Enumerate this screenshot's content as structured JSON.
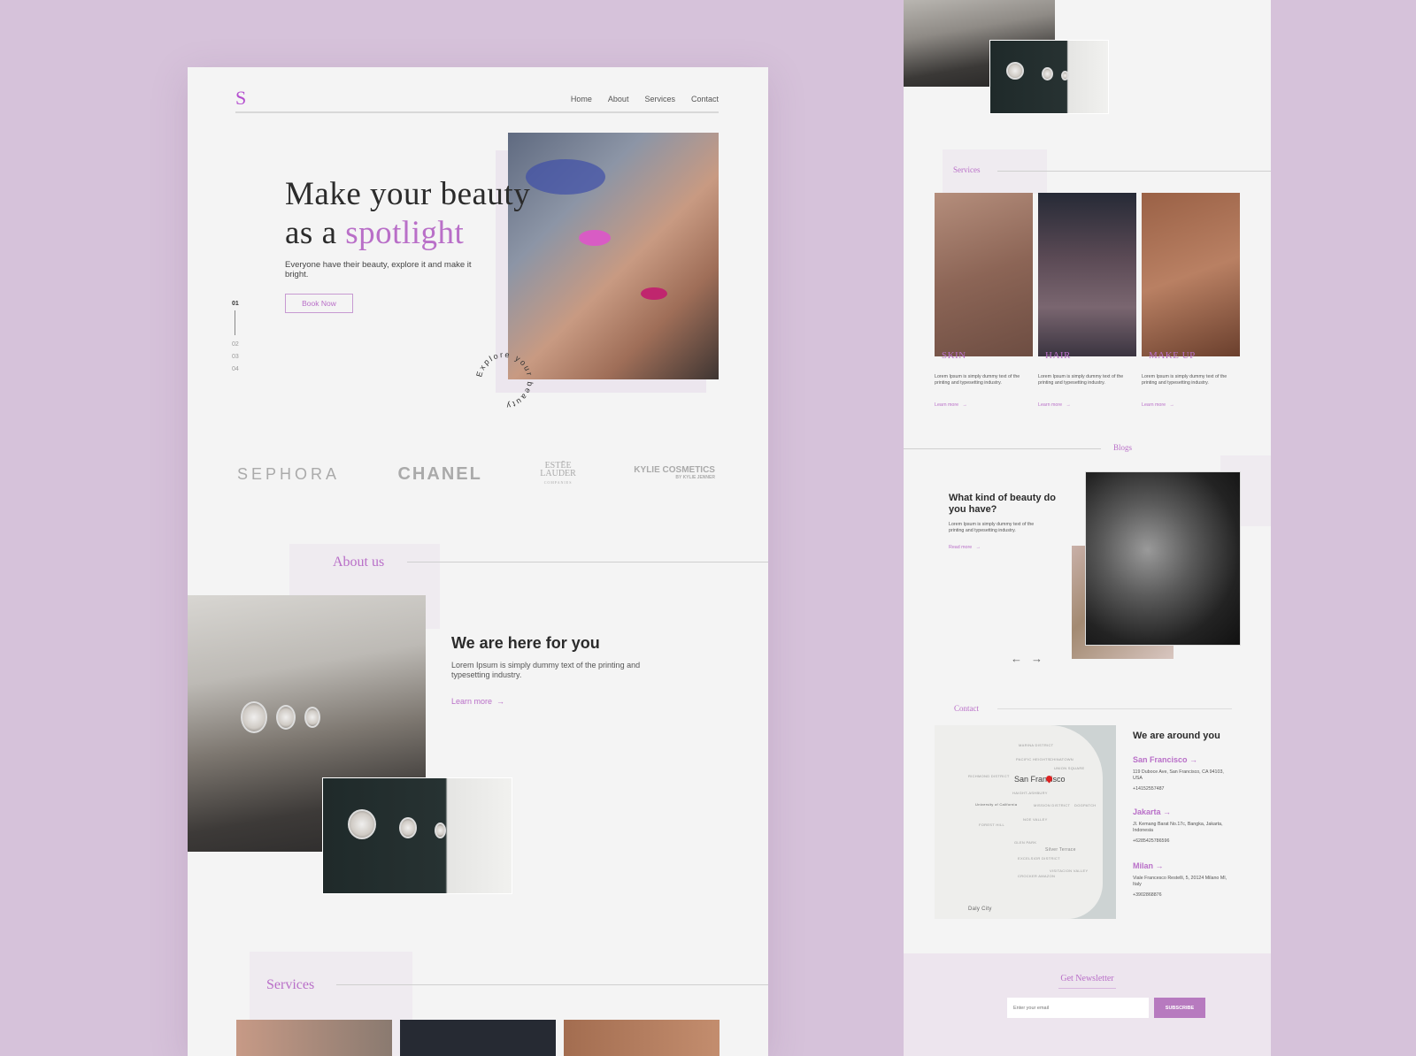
{
  "header": {
    "logo": "S",
    "nav": [
      "Home",
      "About",
      "Services",
      "Contact"
    ]
  },
  "hero": {
    "title_line1": "Make your beauty",
    "title_line2_plain": "as a ",
    "title_line2_accent": "spotlight",
    "subtitle": "Everyone have their beauty, explore it and make it bright.",
    "cta": "Book Now",
    "circle_text": "Explore your beauty",
    "pager": [
      "01",
      "02",
      "03",
      "04"
    ]
  },
  "brands": {
    "sephora": "SEPHORA",
    "chanel": "CHANEL",
    "estee_line1": "ESTĒE",
    "estee_line2": "LAUDER",
    "estee_line3": "COMPANIES",
    "kylie": "KYLIE COSMETICS",
    "kylie_sub": "BY KYLIE JENNER"
  },
  "about": {
    "section_title": "About us",
    "heading": "We are here for you",
    "body": "Lorem Ipsum is simply dummy text of the printing and typesetting industry.",
    "link": "Learn more",
    "arrow": "→"
  },
  "services": {
    "section_title": "Services",
    "cards": [
      {
        "label": "SKIN",
        "text": "Lorem Ipsum is simply dummy text of the printing and typesetting industry.",
        "link": "Learn more"
      },
      {
        "label": "HAIR",
        "text": "Lorem Ipsum is simply dummy text of the printing and typesetting industry.",
        "link": "Learn more"
      },
      {
        "label": "MAKE UP",
        "text": "Lorem Ipsum is simply dummy text of the printing and typesetting industry.",
        "link": "Learn more"
      }
    ],
    "arrow": "→"
  },
  "blogs": {
    "section_title": "Blogs",
    "heading": "What kind of beauty do you have?",
    "body": "Lorem Ipsum is simply dummy text of the printing and typesetting industry.",
    "link": "Read more",
    "arrow": "→",
    "prev": "←",
    "next": "→"
  },
  "contact": {
    "section_title": "Contact",
    "heading": "We are around you",
    "map": {
      "city": "San Francisco",
      "labels": [
        "MARINA DISTRICT",
        "PACIFIC HEIGHTS",
        "CHINATOWN",
        "UNION SQUARE",
        "RICHMOND DISTRICT",
        "HAIGHT-ASHBURY",
        "University of California",
        "MISSION DISTRICT",
        "DOGPATCH",
        "NOE VALLEY",
        "FOREST HILL",
        "GLEN PARK",
        "Silver Terrace",
        "EXCELSIOR DISTRICT",
        "VISITACION VALLEY",
        "CROCKER AMAZON",
        "Daly City"
      ]
    },
    "locations": [
      {
        "name": "San Francisco",
        "address": "119 Duboce Ave, San Francisco, CA 94103, USA",
        "phone": "+14152557487"
      },
      {
        "name": "Jakarta",
        "address": "Jl. Kemang Barat No.17c, Bangka, Jakarta, Indonesia",
        "phone": "+6285425786596"
      },
      {
        "name": "Milan",
        "address": "Viale Francesco Restelli, 5, 20124 Milano MI, Italy",
        "phone": "+3902868876"
      }
    ],
    "arrow": "→"
  },
  "newsletter": {
    "title": "Get Newsletter",
    "placeholder": "Enter your email",
    "button": "SUBSCRIBE"
  },
  "colors": {
    "accent": "#b96fc8",
    "background": "#d6c2da",
    "page": "#f4f4f4",
    "button": "#b77abf"
  }
}
